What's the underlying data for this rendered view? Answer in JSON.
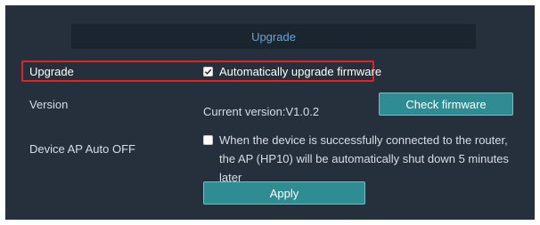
{
  "header": {
    "title": "Upgrade"
  },
  "upgrade_row": {
    "label": "Upgrade",
    "checkbox_checked": true,
    "checkbox_label": "Automatically upgrade firmware"
  },
  "version_row": {
    "label": "Version",
    "value": "Current version:V1.0.2",
    "button_label": "Check firmware"
  },
  "ap_row": {
    "label": "Device AP Auto OFF",
    "checkbox_checked": false,
    "description": "When the device is successfully connected to the router, the AP (HP10) will be automatically shut down 5 minutes later"
  },
  "apply_button": {
    "label": "Apply"
  },
  "colors": {
    "panel_bg": "#25303c",
    "header_bg": "#1b2530",
    "header_text": "#5aa7e0",
    "button_bg": "#2f8c92",
    "highlight_border": "#e02424"
  }
}
